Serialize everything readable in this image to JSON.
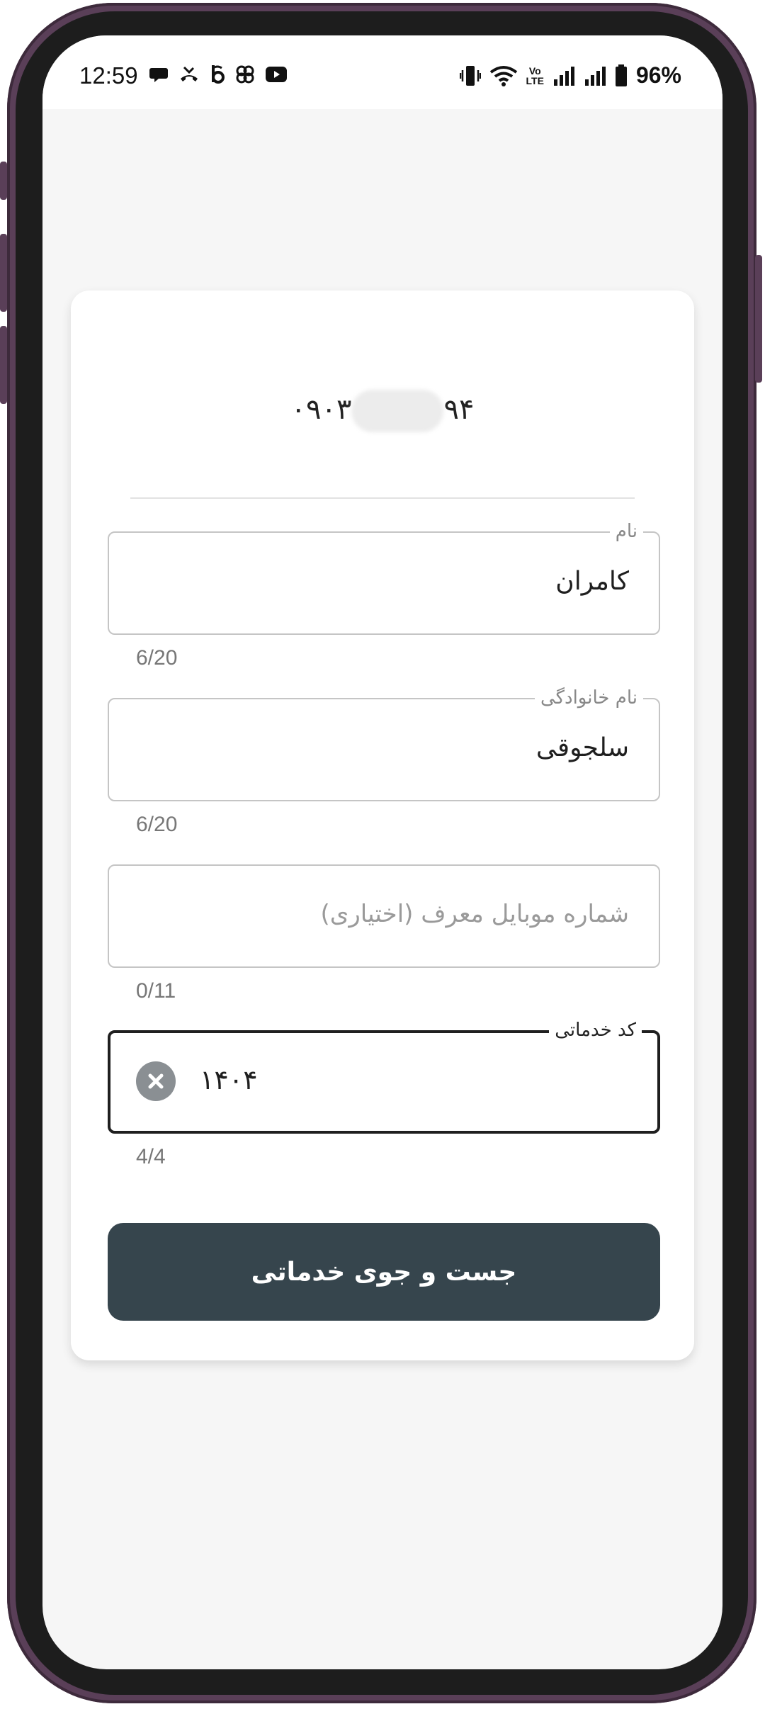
{
  "status_bar": {
    "time": "12:59",
    "left_icons": [
      "chat-bubble-icon",
      "missed-call-icon",
      "b-app-icon",
      "pinwheel-icon",
      "youtube-icon"
    ],
    "right_icons": [
      "vibrate-icon",
      "wifi-icon",
      "volte-icon",
      "signal-1-icon",
      "signal-2-icon",
      "battery-icon"
    ],
    "volte_top": "Vo",
    "volte_bottom": "LTE",
    "battery": "96%"
  },
  "header": {
    "phone_prefix": "۰۹۰۳",
    "phone_suffix": "۹۴"
  },
  "fields": {
    "first_name": {
      "label": "نام",
      "value": "کامران",
      "counter": "6/20"
    },
    "last_name": {
      "label": "نام خانوادگی",
      "value": "سلجوقی",
      "counter": "6/20"
    },
    "referrer": {
      "placeholder": "شماره موبایل معرف (اختیاری)",
      "counter": "0/11"
    },
    "service_code": {
      "label": "کد خدماتی",
      "value": "۱۴۰۴",
      "counter": "4/4",
      "clear_icon": "close-icon"
    }
  },
  "submit_label": "جست و جوی خدماتی",
  "colors": {
    "button": "#36454d",
    "frame": "#5a3f58",
    "screen_bg": "#f6f6f6"
  }
}
